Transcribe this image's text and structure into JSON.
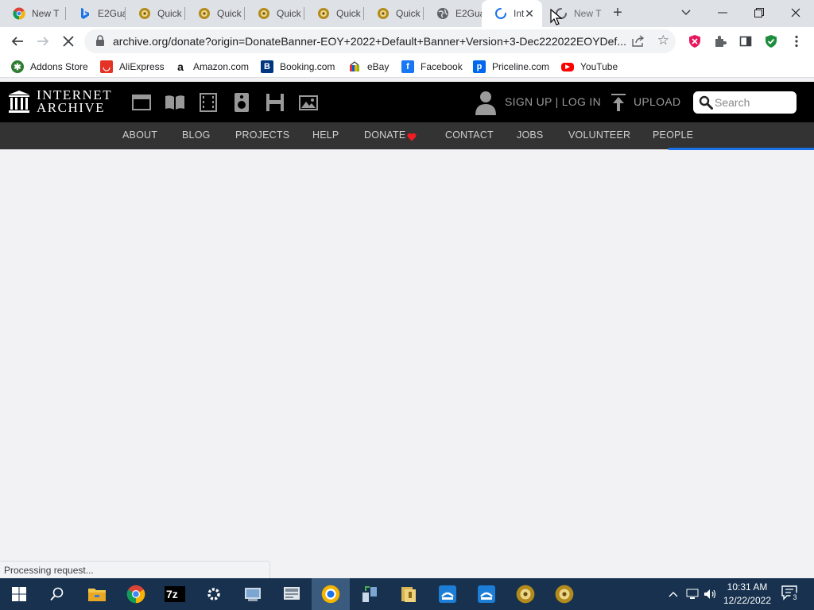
{
  "browser": {
    "tabs": [
      {
        "title": "New T",
        "icon": "chrome-icon"
      },
      {
        "title": "E2Gua",
        "icon": "bing-icon"
      },
      {
        "title": "Quick",
        "icon": "quickhash-icon"
      },
      {
        "title": "Quick",
        "icon": "quickhash-icon"
      },
      {
        "title": "Quick",
        "icon": "quickhash-icon"
      },
      {
        "title": "Quick",
        "icon": "quickhash-icon"
      },
      {
        "title": "Quick",
        "icon": "quickhash-icon"
      },
      {
        "title": "E2Gua",
        "icon": "globe-icon"
      },
      {
        "title": "Int",
        "icon": "loading-spinner-icon",
        "active": true
      },
      {
        "title": "New T",
        "icon": "loading-spinner-icon"
      }
    ],
    "new_tab_label": "+",
    "url": "archive.org/donate?origin=DonateBanner-EOY+2022+Default+Banner+Version+3-Dec222022EOYDef...",
    "bookmarks": [
      {
        "label": "Addons Store",
        "icon": "addons-store-icon",
        "color": "#2e7d32"
      },
      {
        "label": "AliExpress",
        "icon": "aliexpress-icon",
        "color": "#e43225"
      },
      {
        "label": "Amazon.com",
        "icon": "amazon-icon",
        "color": "#ffffff"
      },
      {
        "label": "Booking.com",
        "icon": "booking-icon",
        "color": "#003580"
      },
      {
        "label": "eBay",
        "icon": "ebay-icon",
        "color": "#f5af02"
      },
      {
        "label": "Facebook",
        "icon": "facebook-icon",
        "color": "#1877f2"
      },
      {
        "label": "Priceline.com",
        "icon": "priceline-icon",
        "color": "#0068ef"
      },
      {
        "label": "YouTube",
        "icon": "youtube-icon",
        "color": "#ff0000"
      }
    ],
    "status_text": "Processing request...",
    "loading_color": "#1a73e8"
  },
  "ia": {
    "logo_line1": "INTERNET",
    "logo_line2": "ARCHIVE",
    "media_icons": [
      "web-icon",
      "texts-icon",
      "video-icon",
      "audio-icon",
      "software-icon",
      "images-icon"
    ],
    "signup_label": "SIGN UP | LOG IN",
    "upload_label": "UPLOAD",
    "search_placeholder": "Search",
    "nav": [
      "ABOUT",
      "BLOG",
      "PROJECTS",
      "HELP",
      "DONATE",
      "CONTACT",
      "JOBS",
      "VOLUNTEER",
      "PEOPLE"
    ],
    "donate_heart_color": "#f01c24"
  },
  "taskbar": {
    "apps": [
      "start-icon",
      "search-icon",
      "file-explorer-icon",
      "chrome-icon",
      "7zip-icon",
      "settings-icon",
      "control-panel-icon",
      "device-manager-icon",
      "browser-icon",
      "network-icon",
      "archive-icon",
      "sync-icon",
      "sync-icon",
      "quickhash-icon",
      "quickhash-icon"
    ],
    "time": "10:31 AM",
    "date": "12/22/2022",
    "notification_count": "3"
  }
}
